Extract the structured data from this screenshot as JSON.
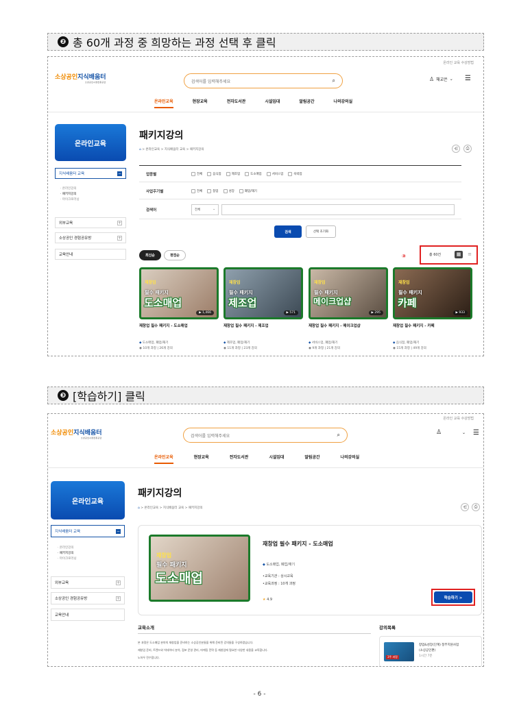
{
  "step2": {
    "num": "❷",
    "text": "총 60개 과정 중 희망하는 과정 선택 후 클릭"
  },
  "step3": {
    "num": "❸",
    "text": "[학습하기] 클릭"
  },
  "site": {
    "logo_main": "소상공인",
    "logo_accent": "지식배움터",
    "logo_sub": "소상공인시장진흥공단",
    "top_right": "온라인 교육 수강방법",
    "search_placeholder": "검색어를 입력해주세요",
    "user": "채교은",
    "gnb": [
      "온라인교육",
      "현장교육",
      "전자도서관",
      "시설임대",
      "알림공간",
      "나의강의실"
    ]
  },
  "lnb": {
    "title": "온라인교육",
    "active": "지식배움터 교육",
    "subs": [
      "· 온라인강의",
      "· 패키지강의",
      "· 마이크로러닝"
    ],
    "items": [
      "외부교육",
      "소상공인 경험공유방",
      "교육안내"
    ]
  },
  "page": {
    "title": "패키지강의",
    "breadcrumb": "> 온라인교육 > 지식배움터 교육 > 패키지강의"
  },
  "filters": {
    "industry_label": "업종별",
    "industry_opts": [
      "전체",
      "음식점",
      "제조업",
      "도소매업",
      "서비스업",
      "숙박업"
    ],
    "cycle_label": "사업주기별",
    "cycle_opts": [
      "전체",
      "창업",
      "성장",
      "폐업/재기"
    ],
    "keyword_label": "검색어",
    "keyword_select": "전체",
    "search_btn": "검색",
    "reset_btn": "선택 초기화"
  },
  "sort": {
    "latest": "최신순",
    "popular": "평점순",
    "total": "총 60건",
    "marker": "③"
  },
  "cards": [
    {
      "t1": "재창업",
      "t2": "필수 패키지",
      "t3": "도소매업",
      "views": "1,466",
      "title": "재창업 필수 패키지 - 도소매업",
      "tags": "도소매업, 폐업/재기",
      "info": "10개 과정 | 26개 강의",
      "bg": "#b89a84"
    },
    {
      "t1": "재창업",
      "t2": "필수 패키지",
      "t3": "제조업",
      "views": "571",
      "title": "재창업 필수 패키지 - 제조업",
      "tags": "제조업, 폐업/재기",
      "info": "11개 과정 | 23개 강의",
      "bg": "#6a7c8a"
    },
    {
      "t1": "재창업",
      "t2": "필수 패키지",
      "t3": "메이크업샵",
      "views": "295",
      "title": "재창업 필수 패키지 - 메이크업샵",
      "tags": "서비스업, 폐업/재기",
      "info": "9개 과정 | 21개 강의",
      "bg": "#8a7a6a"
    },
    {
      "t1": "재창업",
      "t2": "필수 패키지",
      "t3": "카페",
      "views": "933",
      "title": "재창업 필수 패키지 - 카페",
      "tags": "음식점, 폐업/재기",
      "info": "15개 과정 | 49개 강의",
      "bg": "#5a4638"
    }
  ],
  "detail": {
    "title": "재창업 필수 패키지 - 도소매업",
    "tags": "도소매업, 폐업/재기",
    "field1": "•교육기관 : 상시교육",
    "field2": "•교육과정 : 10개 과정",
    "rating": "4.9",
    "learn_btn": "학습하기 >",
    "intro_label": "교육소개",
    "intro_line1": "본 과정은 도소매업 분야의 재창업을 준비하는 소상공인분들을 위해 준비된 강의들을 구성하였습니다.",
    "intro_line2": "재창업 준비, 트렌드와 빅데이터 분석, 점포 운영 관리, 마케팅 전략 등 재창업에 필요한 다양한 내용을 교육합니다.",
    "intro_line3": "노하우 전수합니다.",
    "list_label": "강의목록",
    "list_item1": "창업&성장(단계) 정부지원사업",
    "list_item2": "(소상공인편)",
    "list_item3": "1시간 7분",
    "list_thumb_text": "3주 과정"
  },
  "page_number": "- 6 -"
}
